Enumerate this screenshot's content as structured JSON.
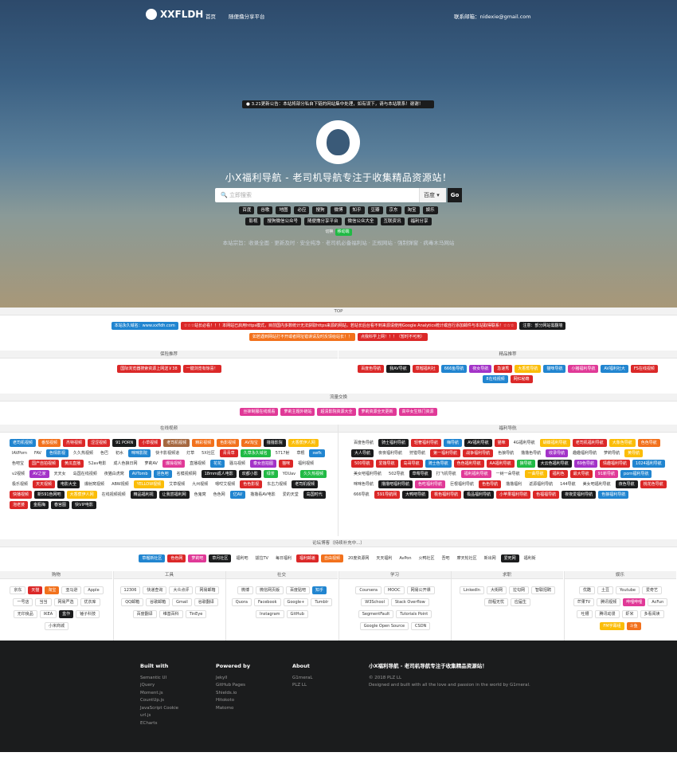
{
  "nav": {
    "brand": "XXFLDH",
    "home": "首页",
    "share": "随便撸分享平台",
    "contact": "联系邮箱：nidexie@gmail.com"
  },
  "hero": {
    "notice": "3.21更新公告：本站将部分私自下链的网站集中处理，如有误下，请与本站联系！谢谢！",
    "title": "小X福利导航 - 老司机导航专注于收集精品资源站！",
    "search_placeholder": "立即搜索",
    "engine": "百度",
    "go": "Go",
    "row1": [
      "百度",
      "谷歌",
      "地图",
      "必应",
      "搜狗",
      "微博",
      "知乎",
      "豆瓣",
      "京东",
      "淘宝",
      "娱乐"
    ],
    "row2": [
      "影视",
      "搜狗微信公众号",
      "随便撸分享平台",
      "微信公众大全",
      "互联资讯",
      "福利分享"
    ],
    "switch1": "切换",
    "switch2": "移动端",
    "slogan": "本站宗旨：收录全面 · 更新及时 · 安全纯净 · 老司机必备福利站 · 正规网站 · 强制弹窗 · 病毒木马网站"
  },
  "top": {
    "title": "TOP"
  },
  "banner": {
    "row1": [
      {
        "label": "本站永久域名：www.xxfldh.com",
        "c": "blue"
      },
      {
        "label": "☆☆☆站长必看！！！本网站已启用https模式，目前国内多数统计无法获取https来源的网站，若站长后台看不到来源请使用Google Analytics统计或自行添加邮件与本站取得联系！☆☆☆",
        "c": "red"
      },
      {
        "label": "注意：部分网站需翻墙",
        "c": "black"
      }
    ],
    "row2": [
      {
        "label": "如若遇到网站打不开或者网址错误请及时反馈给站长！！",
        "c": "orange"
      },
      {
        "label": "点我科学上网！！！（暂时不可用）",
        "c": "red"
      }
    ]
  },
  "left_rec": {
    "title": "保险推荐",
    "items": [
      {
        "label": "国际浏览器搜索资源上网送￥38",
        "c": "red"
      },
      {
        "label": "一键浏览有惊喜！",
        "c": "red"
      }
    ]
  },
  "right_rec": {
    "title": "精品推荐",
    "items": [
      {
        "label": "百度色导航",
        "c": "red"
      },
      {
        "label": "我AV导航",
        "c": "black"
      },
      {
        "label": "草榴福利社",
        "c": "red"
      },
      {
        "label": "666鱼导航",
        "c": "blue"
      },
      {
        "label": "夜女导航",
        "c": "purple"
      },
      {
        "label": "急速秀",
        "c": "red"
      },
      {
        "label": "大香蕉导航",
        "c": "yellow"
      },
      {
        "label": "猫咪导航",
        "c": "blue"
      },
      {
        "label": "小猪福利导航",
        "c": "pink"
      },
      {
        "label": "AV福利社大",
        "c": "blue"
      },
      {
        "label": "FS在线视频",
        "c": "red"
      },
      {
        "label": "8在线视频",
        "c": "blue"
      },
      {
        "label": "网红秘籍",
        "c": "red"
      }
    ]
  },
  "friends": {
    "title": "流量交换",
    "items": [
      {
        "label": "丝袜制服在线观看",
        "c": "pink"
      },
      {
        "label": "萝莉主题外链站",
        "c": "pink"
      },
      {
        "label": "超清影院资源大全",
        "c": "pink"
      },
      {
        "label": "萝莉资源全天更新",
        "c": "pink"
      },
      {
        "label": "高中女生热门资源",
        "c": "pink"
      }
    ]
  },
  "video": {
    "title": "在线视频",
    "items": [
      {
        "label": "老司机视频",
        "c": "blue"
      },
      {
        "label": "番茄视频",
        "c": "orange"
      },
      {
        "label": "杰特视频",
        "c": "red"
      },
      {
        "label": "涩涩视频",
        "c": "red"
      },
      {
        "label": "91 PORN",
        "c": "black"
      },
      {
        "label": "小草视频",
        "c": "red"
      },
      {
        "label": "老司机视频",
        "c": "brown"
      },
      {
        "label": "精彩视频",
        "c": "orange"
      },
      {
        "label": "色影视频",
        "c": "orange"
      },
      {
        "label": "AV淘宝",
        "c": "orange"
      },
      {
        "label": "撸撸影院",
        "c": "black"
      },
      {
        "label": "大香蕉伊人网",
        "c": "yellow"
      },
      {
        "label": "IAVPorn",
        "c": "plain"
      },
      {
        "label": "FAV",
        "c": "plain"
      },
      {
        "label": "色情影视",
        "c": "blue"
      },
      {
        "label": "久久热视频",
        "c": "plain"
      },
      {
        "label": "色巴",
        "c": "plain"
      },
      {
        "label": "初水",
        "c": "plain"
      },
      {
        "label": "咪咪影院",
        "c": "blue"
      },
      {
        "label": "快卡影视频道",
        "c": "plain"
      },
      {
        "label": "灯草",
        "c": "plain"
      },
      {
        "label": "5X社区",
        "c": "plain"
      },
      {
        "label": "青青草",
        "c": "red"
      },
      {
        "label": "久草永久域名",
        "c": "green"
      },
      {
        "label": "5717射",
        "c": "plain"
      },
      {
        "label": "草根",
        "c": "plain"
      },
      {
        "label": "swfk",
        "c": "blue"
      },
      {
        "label": "色吧宝",
        "c": "plain"
      },
      {
        "label": "国产自拍视频",
        "c": "red"
      },
      {
        "label": "黄瓜直播",
        "c": "red"
      },
      {
        "label": "52av电影",
        "c": "plain"
      },
      {
        "label": "成人色狼日网",
        "c": "plain"
      },
      {
        "label": "萝莉AV",
        "c": "plain"
      },
      {
        "label": "爆操视频",
        "c": "pink"
      },
      {
        "label": "直播视频",
        "c": "plain"
      },
      {
        "label": "花花",
        "c": "blue"
      },
      {
        "label": "骚马视频",
        "c": "plain"
      },
      {
        "label": "泰女自拍图",
        "c": "purple"
      },
      {
        "label": "猫咪",
        "c": "red"
      },
      {
        "label": "福利视频",
        "c": "plain"
      },
      {
        "label": "v2视频",
        "c": "plain"
      },
      {
        "label": "AV之家",
        "c": "purple"
      },
      {
        "label": "天天女",
        "c": "plain"
      },
      {
        "label": "岛国在线视频",
        "c": "plain"
      },
      {
        "label": "夜猫白虎窝",
        "c": "plain"
      },
      {
        "label": "AVTomb",
        "c": "blue"
      },
      {
        "label": "淫色吧",
        "c": "blue"
      },
      {
        "label": "名模视频网",
        "c": "plain"
      },
      {
        "label": "18mm成人电影",
        "c": "black"
      },
      {
        "label": "欢都小影",
        "c": "black"
      },
      {
        "label": "绿茶",
        "c": "green"
      },
      {
        "label": "YOUav",
        "c": "plain"
      },
      {
        "label": "久久热视频",
        "c": "green"
      },
      {
        "label": "极乐视频",
        "c": "plain"
      },
      {
        "label": "天天视频",
        "c": "red"
      },
      {
        "label": "电影大全",
        "c": "black"
      },
      {
        "label": "爆射窝视频",
        "c": "plain"
      },
      {
        "label": "ABW视频",
        "c": "plain"
      },
      {
        "label": "YELLOW视频",
        "c": "yellow"
      },
      {
        "label": "艾草视频",
        "c": "plain"
      },
      {
        "label": "九州视频",
        "c": "plain"
      },
      {
        "label": "嗯哎艾视频",
        "c": "plain"
      },
      {
        "label": "色色影视",
        "c": "red"
      },
      {
        "label": "东古力视频",
        "c": "plain"
      },
      {
        "label": "老司机视频",
        "c": "black"
      },
      {
        "label": "快播视频",
        "c": "red"
      },
      {
        "label": "新591色网吧",
        "c": "black"
      },
      {
        "label": "大香蕉伊人网",
        "c": "yellow"
      },
      {
        "label": "在线视频视频",
        "c": "plain"
      },
      {
        "label": "精品福利视",
        "c": "black"
      },
      {
        "label": "让我尝福利网",
        "c": "black"
      },
      {
        "label": "色鬼窝",
        "c": "plain"
      },
      {
        "label": "色色网",
        "c": "plain"
      },
      {
        "label": "亿AV",
        "c": "blue"
      },
      {
        "label": "撸撸看AV电影",
        "c": "plain"
      },
      {
        "label": "爱的天堂",
        "c": "plain"
      },
      {
        "label": "岛国时代",
        "c": "black"
      },
      {
        "label": "泡老婆",
        "c": "red"
      },
      {
        "label": "金瓶梅",
        "c": "black"
      },
      {
        "label": "春宫图",
        "c": "black"
      },
      {
        "label": "快VIP电影",
        "c": "black"
      }
    ]
  },
  "fuli": {
    "title": "福利导航",
    "items": [
      {
        "label": "百度色导航",
        "c": "plain"
      },
      {
        "label": "骑士福利导航",
        "c": "black"
      },
      {
        "label": "轻奢福利导航",
        "c": "red"
      },
      {
        "label": "嗨导航",
        "c": "blue"
      },
      {
        "label": "AV福利导航",
        "c": "black"
      },
      {
        "label": "猫咪",
        "c": "red"
      },
      {
        "label": "4G福利导航",
        "c": "plain"
      },
      {
        "label": "蝴蝶福利导航",
        "c": "yellow"
      },
      {
        "label": "老司机福利导航",
        "c": "red"
      },
      {
        "label": "大象色导航",
        "c": "yellow"
      },
      {
        "label": "色色导航",
        "c": "orange"
      },
      {
        "label": "大人导航",
        "c": "black"
      },
      {
        "label": "夜夜福利导航",
        "c": "plain"
      },
      {
        "label": "狩猎导航",
        "c": "plain"
      },
      {
        "label": "第一福利导航",
        "c": "red"
      },
      {
        "label": "战争福利导航",
        "c": "red"
      },
      {
        "label": "色狼导航",
        "c": "plain"
      },
      {
        "label": "撸撸色导航",
        "c": "plain"
      },
      {
        "label": "收录导航",
        "c": "purple"
      },
      {
        "label": "趣趣福利导航",
        "c": "plain"
      },
      {
        "label": "萝莉导航",
        "c": "plain"
      },
      {
        "label": "黄导航",
        "c": "yellow"
      },
      {
        "label": "500导航",
        "c": "red"
      },
      {
        "label": "爱撸导航",
        "c": "red"
      },
      {
        "label": "岛哥导航",
        "c": "red"
      },
      {
        "label": "骑士色导航",
        "c": "blue"
      },
      {
        "label": "色色福利导航",
        "c": "red"
      },
      {
        "label": "AA福利导航",
        "c": "red"
      },
      {
        "label": "狼导航",
        "c": "green"
      },
      {
        "label": "大云色福利导航",
        "c": "black"
      },
      {
        "label": "69色导航",
        "c": "purple"
      },
      {
        "label": "情趣福利导航",
        "c": "red"
      },
      {
        "label": "1024福利导航",
        "c": "blue"
      },
      {
        "label": "美女吧福利导航",
        "c": "plain"
      },
      {
        "label": "502导航",
        "c": "plain"
      },
      {
        "label": "草莓导航",
        "c": "black"
      },
      {
        "label": "打飞机导航",
        "c": "plain"
      },
      {
        "label": "福利福利导航",
        "c": "pink"
      },
      {
        "label": "一树一朵导航",
        "c": "plain"
      },
      {
        "label": "一曲导航",
        "c": "yellow"
      },
      {
        "label": "福利色",
        "c": "red"
      },
      {
        "label": "最大导航",
        "c": "red"
      },
      {
        "label": "91新导航",
        "c": "pink"
      },
      {
        "label": "porn福利导航",
        "c": "blue"
      },
      {
        "label": "咪咪色导航",
        "c": "plain"
      },
      {
        "label": "撸撸吧福利导航",
        "c": "black"
      },
      {
        "label": "色吃福利导航",
        "c": "pink"
      },
      {
        "label": "巨根福利导航",
        "c": "plain"
      },
      {
        "label": "色色导航",
        "c": "red"
      },
      {
        "label": "撸撸福利",
        "c": "plain"
      },
      {
        "label": "返源福利导航",
        "c": "plain"
      },
      {
        "label": "144导航",
        "c": "plain"
      },
      {
        "label": "美女吧福利导航",
        "c": "plain"
      },
      {
        "label": "夜色导航",
        "c": "black"
      },
      {
        "label": "桃花色导航",
        "c": "red"
      },
      {
        "label": "666导航",
        "c": "plain"
      },
      {
        "label": "591导航网",
        "c": "red"
      },
      {
        "label": "大鸭吧导航",
        "c": "black"
      },
      {
        "label": "桃色福利导航",
        "c": "red"
      },
      {
        "label": "极品福利导航",
        "c": "black"
      },
      {
        "label": "小苹果福利导航",
        "c": "red"
      },
      {
        "label": "色福福导航",
        "c": "red"
      },
      {
        "label": "夜夜爱福利导航",
        "c": "black"
      },
      {
        "label": "色狼福利导航",
        "c": "blue"
      }
    ]
  },
  "forum": {
    "title": "论坛博客（持续补充中...）",
    "items": [
      {
        "label": "草榴新社区",
        "c": "blue"
      },
      {
        "label": "色色网",
        "c": "red"
      },
      {
        "label": "萝莉吧",
        "c": "pink"
      },
      {
        "label": "草月社区",
        "c": "black"
      },
      {
        "label": "福利吧",
        "c": "plain"
      },
      {
        "label": "拔拉TV",
        "c": "plain"
      },
      {
        "label": "每日福利",
        "c": "plain"
      },
      {
        "label": "福利邮差",
        "c": "red"
      },
      {
        "label": "自由视频",
        "c": "orange"
      },
      {
        "label": "20度资源网",
        "c": "plain"
      },
      {
        "label": "天天福利",
        "c": "plain"
      },
      {
        "label": "AvPon",
        "c": "plain"
      },
      {
        "label": "火鸭社区",
        "c": "plain"
      },
      {
        "label": "吾吧",
        "c": "plain"
      },
      {
        "label": "摩天轮社区",
        "c": "plain"
      },
      {
        "label": "新出网",
        "c": "plain"
      },
      {
        "label": "爱死网",
        "c": "black"
      },
      {
        "label": "福利街",
        "c": "plain"
      }
    ]
  },
  "cols": [
    {
      "title": "购物",
      "items": [
        {
          "label": "京东",
          "c": "plain"
        },
        {
          "label": "天猫",
          "c": "red"
        },
        {
          "label": "淘宝",
          "c": "orange"
        },
        {
          "label": "亚马逊",
          "c": "plain"
        },
        {
          "label": "Apple",
          "c": "plain"
        },
        {
          "label": "一号店",
          "c": "plain"
        },
        {
          "label": "当当",
          "c": "plain"
        },
        {
          "label": "网易严选",
          "c": "plain"
        },
        {
          "label": "优衣库",
          "c": "plain"
        },
        {
          "label": "无印良品",
          "c": "plain"
        },
        {
          "label": "IKEA",
          "c": "plain"
        },
        {
          "label": "盒作",
          "c": "black"
        },
        {
          "label": "锤子科技",
          "c": "plain"
        },
        {
          "label": "小米商城",
          "c": "plain"
        }
      ]
    },
    {
      "title": "工具",
      "items": [
        {
          "label": "12306",
          "c": "plain"
        },
        {
          "label": "快递查询",
          "c": "plain"
        },
        {
          "label": "大众点评",
          "c": "plain"
        },
        {
          "label": "网易邮箱",
          "c": "plain"
        },
        {
          "label": "QQ邮箱",
          "c": "plain"
        },
        {
          "label": "谷歌邮箱",
          "c": "plain"
        },
        {
          "label": "Gmail",
          "c": "plain"
        },
        {
          "label": "谷歌翻译",
          "c": "plain"
        },
        {
          "label": "百度翻译",
          "c": "plain"
        },
        {
          "label": "维基百科",
          "c": "plain"
        },
        {
          "label": "TinEye",
          "c": "plain"
        }
      ]
    },
    {
      "title": "社交",
      "items": [
        {
          "label": "微博",
          "c": "plain"
        },
        {
          "label": "微信网页版",
          "c": "plain"
        },
        {
          "label": "百度贴吧",
          "c": "plain"
        },
        {
          "label": "知乎",
          "c": "blue"
        },
        {
          "label": "Quora",
          "c": "plain"
        },
        {
          "label": "Facebook",
          "c": "plain"
        },
        {
          "label": "Google+",
          "c": "plain"
        },
        {
          "label": "Tumblr",
          "c": "plain"
        },
        {
          "label": "Instagram",
          "c": "plain"
        },
        {
          "label": "GitHub",
          "c": "plain"
        }
      ]
    },
    {
      "title": "学习",
      "items": [
        {
          "label": "Coursera",
          "c": "plain"
        },
        {
          "label": "MOOC",
          "c": "plain"
        },
        {
          "label": "网易公开课",
          "c": "plain"
        },
        {
          "label": "W3School",
          "c": "plain"
        },
        {
          "label": "Stack Overflow",
          "c": "plain"
        },
        {
          "label": "SegmentFault",
          "c": "plain"
        },
        {
          "label": "Tutorials Point",
          "c": "plain"
        },
        {
          "label": "Google Open Source",
          "c": "plain"
        },
        {
          "label": "CSDN",
          "c": "plain"
        }
      ]
    },
    {
      "title": "求职",
      "items": [
        {
          "label": "LinkedIn",
          "c": "plain"
        },
        {
          "label": "大街网",
          "c": "plain"
        },
        {
          "label": "拉勾网",
          "c": "plain"
        },
        {
          "label": "智联招聘",
          "c": "plain"
        },
        {
          "label": "前程无忧",
          "c": "plain"
        },
        {
          "label": "应届生",
          "c": "plain"
        }
      ]
    },
    {
      "title": "娱乐",
      "items": [
        {
          "label": "优酷",
          "c": "plain"
        },
        {
          "label": "土豆",
          "c": "plain"
        },
        {
          "label": "Youtube",
          "c": "plain"
        },
        {
          "label": "爱奇艺",
          "c": "plain"
        },
        {
          "label": "芒果TV",
          "c": "plain"
        },
        {
          "label": "腾讯视频",
          "c": "plain"
        },
        {
          "label": "哔哩哔哩",
          "c": "pink"
        },
        {
          "label": "AcFun",
          "c": "plain"
        },
        {
          "label": "吐槽",
          "c": "plain"
        },
        {
          "label": "腾讯动漫",
          "c": "plain"
        },
        {
          "label": "虾米",
          "c": "plain"
        },
        {
          "label": "多看阅读",
          "c": "plain"
        },
        {
          "label": "FM字幕组",
          "c": "yellow"
        },
        {
          "label": "斗鱼",
          "c": "orange"
        }
      ]
    }
  ],
  "footer": {
    "built": {
      "title": "Built with",
      "items": [
        "Semantic UI",
        "jQuery",
        "Moment.js",
        "CountUp.js",
        "JavaScript Cookie",
        "url.js",
        "ECharts"
      ]
    },
    "powered": {
      "title": "Powered by",
      "items": [
        "Jekyll",
        "GitHub Pages",
        "Shields.io",
        "Hitokoto",
        "Matomo"
      ]
    },
    "about": {
      "title": "About",
      "items": [
        "G1rnerаL",
        "PLZ LL"
      ]
    },
    "site": {
      "title": "小X福利导航 - 老司机导航专注于收集精品资源站！",
      "copy": "© 2018 PLZ LL",
      "desc": "Designed and built with all the love and passion in the world by G1rneral."
    }
  }
}
